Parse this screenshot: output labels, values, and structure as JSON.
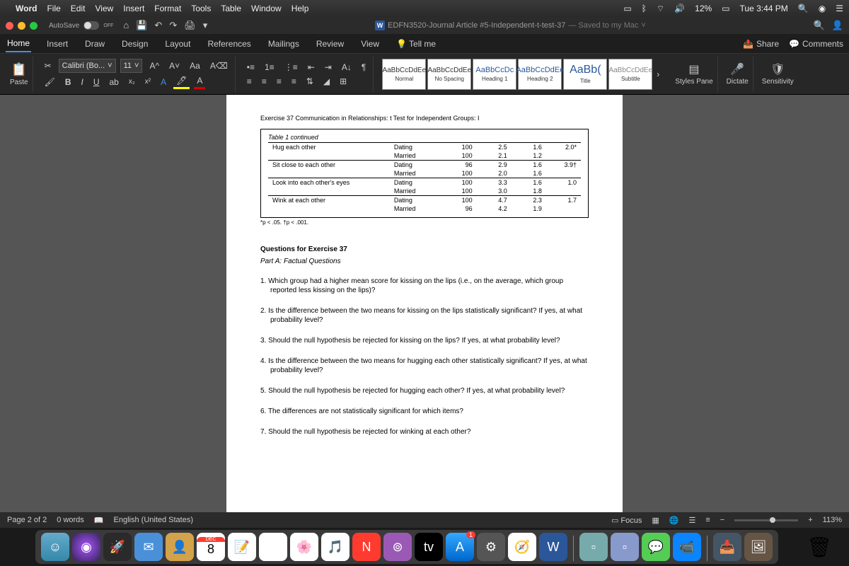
{
  "menubar": {
    "app": "Word",
    "items": [
      "File",
      "Edit",
      "View",
      "Insert",
      "Format",
      "Tools",
      "Table",
      "Window",
      "Help"
    ],
    "battery": "12%",
    "time": "Tue 3:44 PM"
  },
  "titlebar": {
    "autosave_label": "AutoSave",
    "autosave_state": "OFF",
    "doc_name": "EDFN3520-Journal Article #5-Independent-t-test-37",
    "saved_text": "— Saved to my Mac"
  },
  "ribbon": {
    "tabs": [
      "Home",
      "Insert",
      "Draw",
      "Design",
      "Layout",
      "References",
      "Mailings",
      "Review",
      "View"
    ],
    "tellme": "Tell me",
    "share": "Share",
    "comments": "Comments",
    "paste": "Paste",
    "font_name": "Calibri (Bo...",
    "font_size": "11",
    "styles": [
      {
        "preview": "AaBbCcDdEe",
        "label": "Normal"
      },
      {
        "preview": "AaBbCcDdEe",
        "label": "No Spacing"
      },
      {
        "preview": "AaBbCcDc",
        "label": "Heading 1"
      },
      {
        "preview": "AaBbCcDdEe",
        "label": "Heading 2"
      },
      {
        "preview": "AaBb(",
        "label": "Title"
      },
      {
        "preview": "AaBbCcDdEe",
        "label": "Subtitle"
      }
    ],
    "styles_pane": "Styles Pane",
    "dictate": "Dictate",
    "sensitivity": "Sensitivity"
  },
  "document": {
    "exercise_header": "Exercise 37  Communication in Relationships: t Test for Independent Groups: I",
    "table_caption": "Table 1 continued",
    "rows": [
      {
        "act": "Hug each other",
        "grp": "Dating",
        "n": "100",
        "m": "2.5",
        "sd": "1.6",
        "t": "2.0*"
      },
      {
        "act": "",
        "grp": "Married",
        "n": "100",
        "m": "2.1",
        "sd": "1.2",
        "t": ""
      },
      {
        "act": "Sit close to each other",
        "grp": "Dating",
        "n": "96",
        "m": "2.9",
        "sd": "1.6",
        "t": "3.9†"
      },
      {
        "act": "",
        "grp": "Married",
        "n": "100",
        "m": "2.0",
        "sd": "1.6",
        "t": ""
      },
      {
        "act": "Look into each other's eyes",
        "grp": "Dating",
        "n": "100",
        "m": "3.3",
        "sd": "1.6",
        "t": "1.0"
      },
      {
        "act": "",
        "grp": "Married",
        "n": "100",
        "m": "3.0",
        "sd": "1.8",
        "t": ""
      },
      {
        "act": "Wink at each other",
        "grp": "Dating",
        "n": "100",
        "m": "4.7",
        "sd": "2.3",
        "t": "1.7"
      },
      {
        "act": "",
        "grp": "Married",
        "n": "96",
        "m": "4.2",
        "sd": "1.9",
        "t": ""
      }
    ],
    "footnote": "*p < .05. †p < .001.",
    "section_title": "Questions for Exercise 37",
    "section_sub": "Part A: Factual Questions",
    "questions": [
      "1. Which group had a higher mean score for kissing on the lips (i.e., on the average, which group reported less kissing on the lips)?",
      "2. Is the difference between the two means for kissing on the lips statistically significant? If yes, at what probability level?",
      "3. Should the null hypothesis be rejected for kissing on the lips? If yes, at what probability level?",
      "4. Is the difference between the two means for hugging each other statistically significant? If yes, at what probability level?",
      "5. Should the null hypothesis be rejected for hugging each other? If yes, at what probability level?",
      "6. The differences are not statistically significant for which items?",
      "7. Should the null hypothesis be rejected for winking at each other?"
    ]
  },
  "statusbar": {
    "page": "Page 2 of 2",
    "words": "0 words",
    "lang": "English (United States)",
    "focus": "Focus",
    "zoom": "113%"
  },
  "dock": {
    "cal_month": "DEC",
    "cal_day": "8",
    "tv": "tv",
    "word": "W",
    "badge": "1"
  }
}
